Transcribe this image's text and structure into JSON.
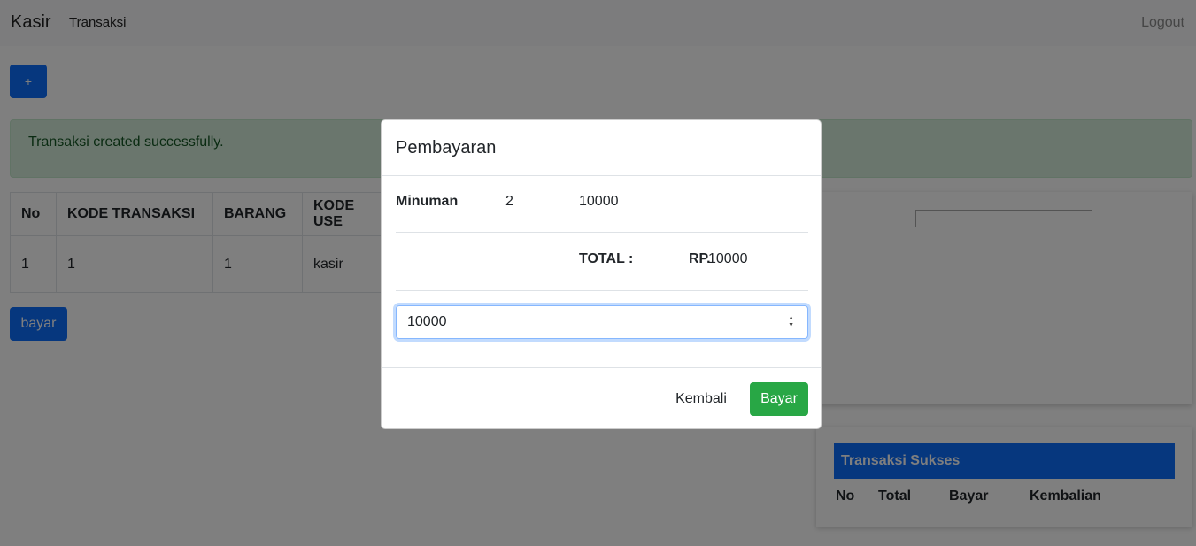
{
  "navbar": {
    "brand": "Kasir",
    "link_transaksi": "Transaksi",
    "logout": "Logout"
  },
  "add_button": {
    "label": "+"
  },
  "alert": {
    "message": "Transaksi created successfully."
  },
  "table": {
    "headers": [
      "No",
      "KODE TRANSAKSI",
      "BARANG",
      "KODE USE"
    ],
    "rows": [
      [
        "1",
        "1",
        "1",
        "kasir"
      ]
    ]
  },
  "bayar_button": {
    "label": "bayar"
  },
  "sukses": {
    "title": "Transaksi Sukses",
    "columns": [
      "No",
      "Total",
      "Bayar",
      "Kembalian"
    ]
  },
  "modal": {
    "title": "Pembayaran",
    "item": {
      "name": "Minuman",
      "qty": "2",
      "price": "10000"
    },
    "total_label": "TOTAL :",
    "currency_label": "RP.",
    "total_value": "10000",
    "payment_value": "10000",
    "kembali_label": "Kembali",
    "bayar_label": "Bayar"
  },
  "colors": {
    "primary": "#0d6efd",
    "success": "#28a745",
    "alert_bg": "#d4edda"
  }
}
